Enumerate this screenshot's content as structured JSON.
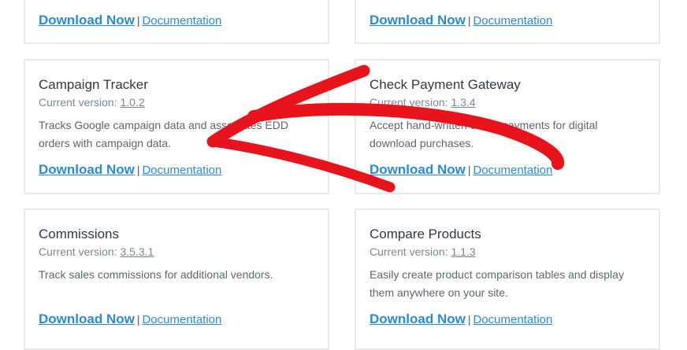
{
  "top_row": {
    "left": {
      "download": "Download Now",
      "separator": "|",
      "docs": "Documentation"
    },
    "right": {
      "download": "Download Now",
      "separator": "|",
      "docs": "Documentation"
    }
  },
  "cards": [
    {
      "title": "Campaign Tracker",
      "version_label": "Current version:",
      "version": "1.0.2",
      "description": "Tracks Google campaign data and associates EDD orders with campaign data.",
      "download": "Download Now",
      "separator": "|",
      "docs": "Documentation"
    },
    {
      "title": "Check Payment Gateway",
      "version_label": "Current version:",
      "version": "1.3.4",
      "description": "Accept hand-written check payments for digital download purchases.",
      "download": "Download Now",
      "separator": "|",
      "docs": "Documentation"
    },
    {
      "title": "Commissions",
      "version_label": "Current version:",
      "version": "3.5.3.1",
      "description": "Track sales commissions for additional vendors.",
      "download": "Download Now",
      "separator": "|",
      "docs": "Documentation"
    },
    {
      "title": "Compare Products",
      "version_label": "Current version:",
      "version": "1.1.3",
      "description": "Easily create product comparison tables and display them anywhere on your site.",
      "download": "Download Now",
      "separator": "|",
      "docs": "Documentation"
    }
  ],
  "colors": {
    "link": "#2b8ad6",
    "border": "#e6ebf1",
    "annotation_arrow": "#e8141c"
  }
}
